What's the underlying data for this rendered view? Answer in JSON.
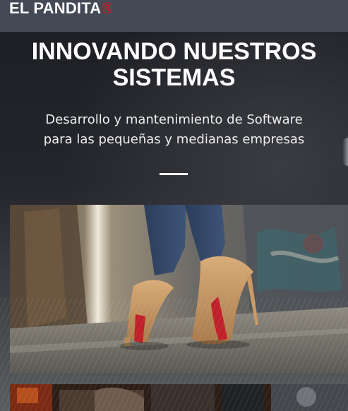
{
  "navbar": {
    "brand_name": "EL PANDITA",
    "brand_mark": "®"
  },
  "hero": {
    "title_line1": "INNOVANDO NUESTROS",
    "title_line2": "SISTEMAS",
    "subtitle_line1": "Desarrollo y mantenimiento de Software",
    "subtitle_line2": "para las pequeñas y medianas empresas"
  },
  "colors": {
    "navbar_bg": "#434955",
    "brand_accent": "#c81e2c",
    "text": "#ffffff"
  },
  "images": [
    {
      "name": "red-sole-heels-street-photo"
    },
    {
      "name": "bar-interior-photo"
    }
  ]
}
